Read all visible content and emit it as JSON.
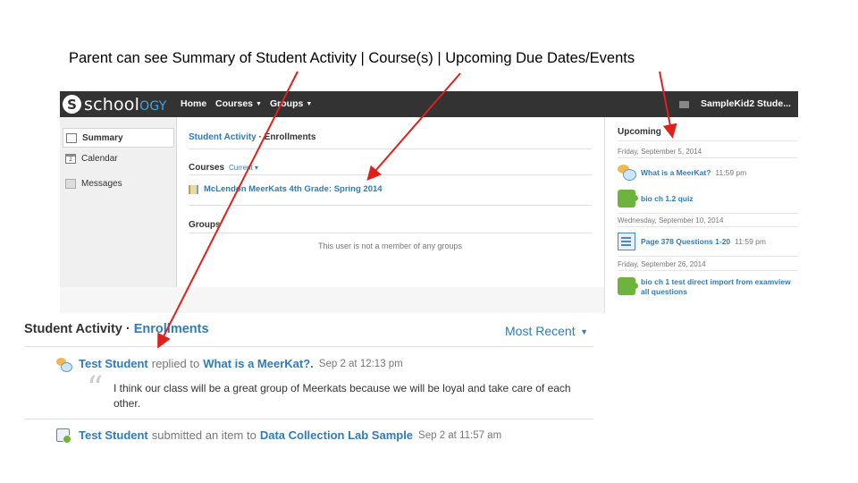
{
  "caption": "Parent can see Summary of Student Activity | Course(s) | Upcoming Due Dates/Events",
  "app": {
    "logo_initial": "S",
    "logo_text": "school",
    "logo_text_suffix": "OGY",
    "nav": [
      {
        "label": "Home"
      },
      {
        "label": "Courses"
      },
      {
        "label": "Groups"
      }
    ],
    "user_name": "SampleKid2 Stude..."
  },
  "sidebar": {
    "items": [
      {
        "label": "Summary",
        "icon": "summary-icon",
        "active": true
      },
      {
        "label": "Calendar",
        "icon": "calendar-icon",
        "active": false
      },
      {
        "label": "Messages",
        "icon": "messages-icon",
        "active": false
      }
    ],
    "calendar_day": "2"
  },
  "main": {
    "breadcrumb_link": "Student Activity",
    "breadcrumb_sep": "·",
    "breadcrumb_current": "Enrollments",
    "courses_heading": "Courses",
    "courses_filter": "Current",
    "course_name": "McLendon MeerKats 4th Grade: Spring 2014",
    "groups_heading": "Groups",
    "groups_empty": "This user is not a member of any groups"
  },
  "upcoming": {
    "title": "Upcoming",
    "groups": [
      {
        "date": "Friday, September 5, 2014",
        "items": [
          {
            "title": "What is a MeerKat?",
            "time": "11:59 pm",
            "icon": "discussion-icon"
          },
          {
            "title": "bio ch 1.2 quiz",
            "time": "",
            "icon": "quiz-icon"
          }
        ]
      },
      {
        "date": "Wednesday, September 10, 2014",
        "items": [
          {
            "title": "Page 378 Questions 1-20",
            "time": "11:59 pm",
            "icon": "assignment-icon"
          }
        ]
      },
      {
        "date": "Friday, September 26, 2014",
        "items": [
          {
            "title": "bio ch 1 test direct import from examview",
            "title_line2": "all questions",
            "time": "",
            "icon": "quiz-icon"
          }
        ]
      }
    ]
  },
  "feed": {
    "heading": "Student Activity",
    "heading_sep": "·",
    "heading_link": "Enrollments",
    "sort_label": "Most Recent",
    "entries": [
      {
        "who": "Test Student",
        "verb": "replied to",
        "object": "What is a MeerKat?.",
        "when": "Sep 2 at 12:13 pm",
        "quote_mark": "“",
        "quote": "I think our class will be a great group of Meerkats because we will be loyal and take care of each other."
      },
      {
        "who": "Test Student",
        "verb": "submitted an item to",
        "object": "Data Collection Lab Sample",
        "when": "Sep 2 at 11:57 am"
      }
    ]
  },
  "colors": {
    "topbar": "#333333",
    "link": "#2e7cb8",
    "arrow": "#e0201b"
  }
}
